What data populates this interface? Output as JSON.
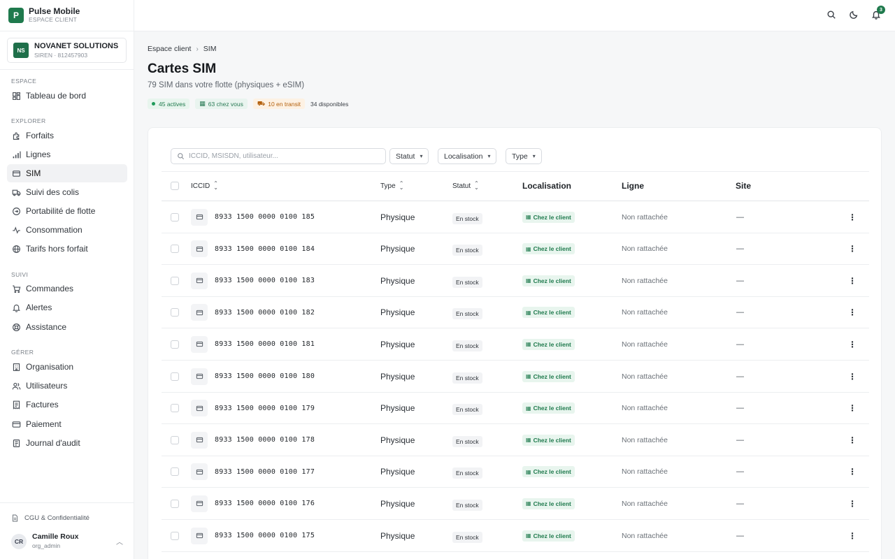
{
  "brand": {
    "logo_letter": "P",
    "name": "Pulse Mobile",
    "subtitle": "ESPACE CLIENT"
  },
  "org": {
    "initials": "NS",
    "name": "NOVANET SOLUTIONS",
    "siren": "SIREN · 812457903"
  },
  "nav": {
    "sections": [
      {
        "label": "ESPACE"
      },
      {
        "label": "EXPLORER"
      },
      {
        "label": "SUIVI"
      },
      {
        "label": "GÉRER"
      }
    ],
    "items": [
      {
        "label": "Tableau de bord",
        "icon": "dashboard-icon"
      },
      {
        "label": "Forfaits",
        "icon": "puzzle-icon"
      },
      {
        "label": "Lignes",
        "icon": "signal-bars-icon"
      },
      {
        "label": "SIM",
        "icon": "sim-card-icon",
        "active": true
      },
      {
        "label": "Suivi des colis",
        "icon": "truck-icon"
      },
      {
        "label": "Portabilité de flotte",
        "icon": "transfer-icon"
      },
      {
        "label": "Consommation",
        "icon": "activity-icon"
      },
      {
        "label": "Tarifs hors forfait",
        "icon": "globe-icon"
      },
      {
        "label": "Commandes",
        "icon": "cart-icon"
      },
      {
        "label": "Alertes",
        "icon": "bell-icon"
      },
      {
        "label": "Assistance",
        "icon": "lifebuoy-icon"
      },
      {
        "label": "Organisation",
        "icon": "building-icon"
      },
      {
        "label": "Utilisateurs",
        "icon": "users-icon"
      },
      {
        "label": "Factures",
        "icon": "receipt-icon"
      },
      {
        "label": "Paiement",
        "icon": "credit-card-icon"
      },
      {
        "label": "Journal d'audit",
        "icon": "audit-log-icon"
      }
    ]
  },
  "footer": {
    "legal_link": "CGU & Confidentialité"
  },
  "user": {
    "initials": "CR",
    "name": "Camille Roux",
    "role": "org_admin"
  },
  "topbar": {
    "notification_count": "3"
  },
  "breadcrumb": {
    "root": "Espace client",
    "current": "SIM"
  },
  "page": {
    "title": "Cartes SIM",
    "subtitle": "79 SIM dans votre flotte (physiques + eSIM)",
    "pills": {
      "active": "45 actives",
      "with_you": "63 chez vous",
      "in_transit": "10 en transit",
      "available": "34 disponibles"
    }
  },
  "filters": {
    "search_placeholder": "ICCID, MSISDN, utilisateur...",
    "statut": "Statut",
    "localisation": "Localisation",
    "type": "Type"
  },
  "table": {
    "columns": {
      "iccid": "ICCID",
      "type": "Type",
      "statut": "Statut",
      "localisation": "Localisation",
      "ligne": "Ligne",
      "site": "Site"
    },
    "rows": [
      {
        "iccid": "8933 1500 0000 0100 185",
        "type": "Physique",
        "status": "En stock",
        "location": "Chez le client",
        "line": "Non rattachée",
        "site": "—"
      },
      {
        "iccid": "8933 1500 0000 0100 184",
        "type": "Physique",
        "status": "En stock",
        "location": "Chez le client",
        "line": "Non rattachée",
        "site": "—"
      },
      {
        "iccid": "8933 1500 0000 0100 183",
        "type": "Physique",
        "status": "En stock",
        "location": "Chez le client",
        "line": "Non rattachée",
        "site": "—"
      },
      {
        "iccid": "8933 1500 0000 0100 182",
        "type": "Physique",
        "status": "En stock",
        "location": "Chez le client",
        "line": "Non rattachée",
        "site": "—"
      },
      {
        "iccid": "8933 1500 0000 0100 181",
        "type": "Physique",
        "status": "En stock",
        "location": "Chez le client",
        "line": "Non rattachée",
        "site": "—"
      },
      {
        "iccid": "8933 1500 0000 0100 180",
        "type": "Physique",
        "status": "En stock",
        "location": "Chez le client",
        "line": "Non rattachée",
        "site": "—"
      },
      {
        "iccid": "8933 1500 0000 0100 179",
        "type": "Physique",
        "status": "En stock",
        "location": "Chez le client",
        "line": "Non rattachée",
        "site": "—"
      },
      {
        "iccid": "8933 1500 0000 0100 178",
        "type": "Physique",
        "status": "En stock",
        "location": "Chez le client",
        "line": "Non rattachée",
        "site": "—"
      },
      {
        "iccid": "8933 1500 0000 0100 177",
        "type": "Physique",
        "status": "En stock",
        "location": "Chez le client",
        "line": "Non rattachée",
        "site": "—"
      },
      {
        "iccid": "8933 1500 0000 0100 176",
        "type": "Physique",
        "status": "En stock",
        "location": "Chez le client",
        "line": "Non rattachée",
        "site": "—"
      },
      {
        "iccid": "8933 1500 0000 0100 175",
        "type": "Physique",
        "status": "En stock",
        "location": "Chez le client",
        "line": "Non rattachée",
        "site": "—"
      }
    ]
  },
  "colors": {
    "brand": "#1f7a4d",
    "accent_green_bg": "#e8f5ee",
    "transit_orange": "#b35f0b"
  }
}
